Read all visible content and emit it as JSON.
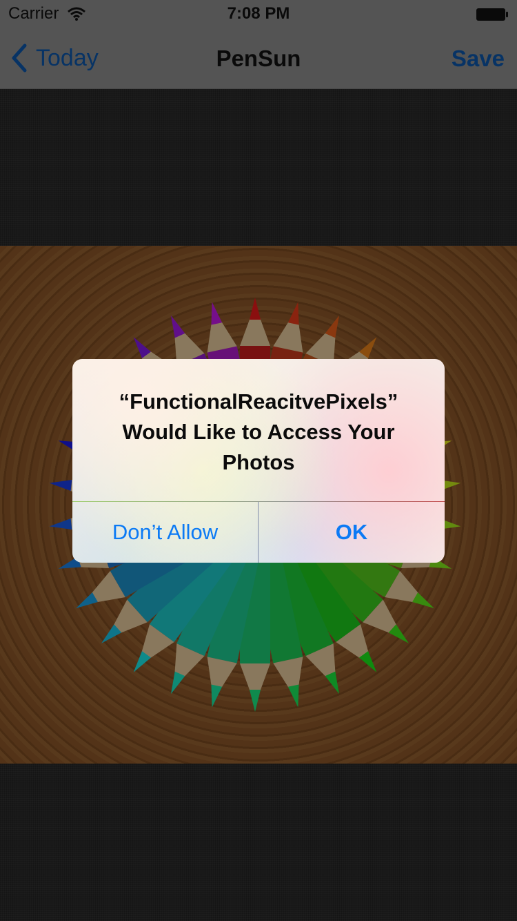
{
  "status_bar": {
    "carrier": "Carrier",
    "time": "7:08 PM",
    "wifi_icon": "wifi-icon",
    "battery_icon": "battery-icon"
  },
  "nav_bar": {
    "back_label": "Today",
    "title": "PenSun",
    "save_label": "Save",
    "tint_color": "#0c56a8"
  },
  "alert": {
    "message_line1": "“FunctionalReacitvePixels”",
    "message_line2": "Would Like to Access Your",
    "message_line3": "Photos",
    "dont_allow_label": "Don’t Allow",
    "ok_label": "OK",
    "button_color": "#0b7af5"
  }
}
